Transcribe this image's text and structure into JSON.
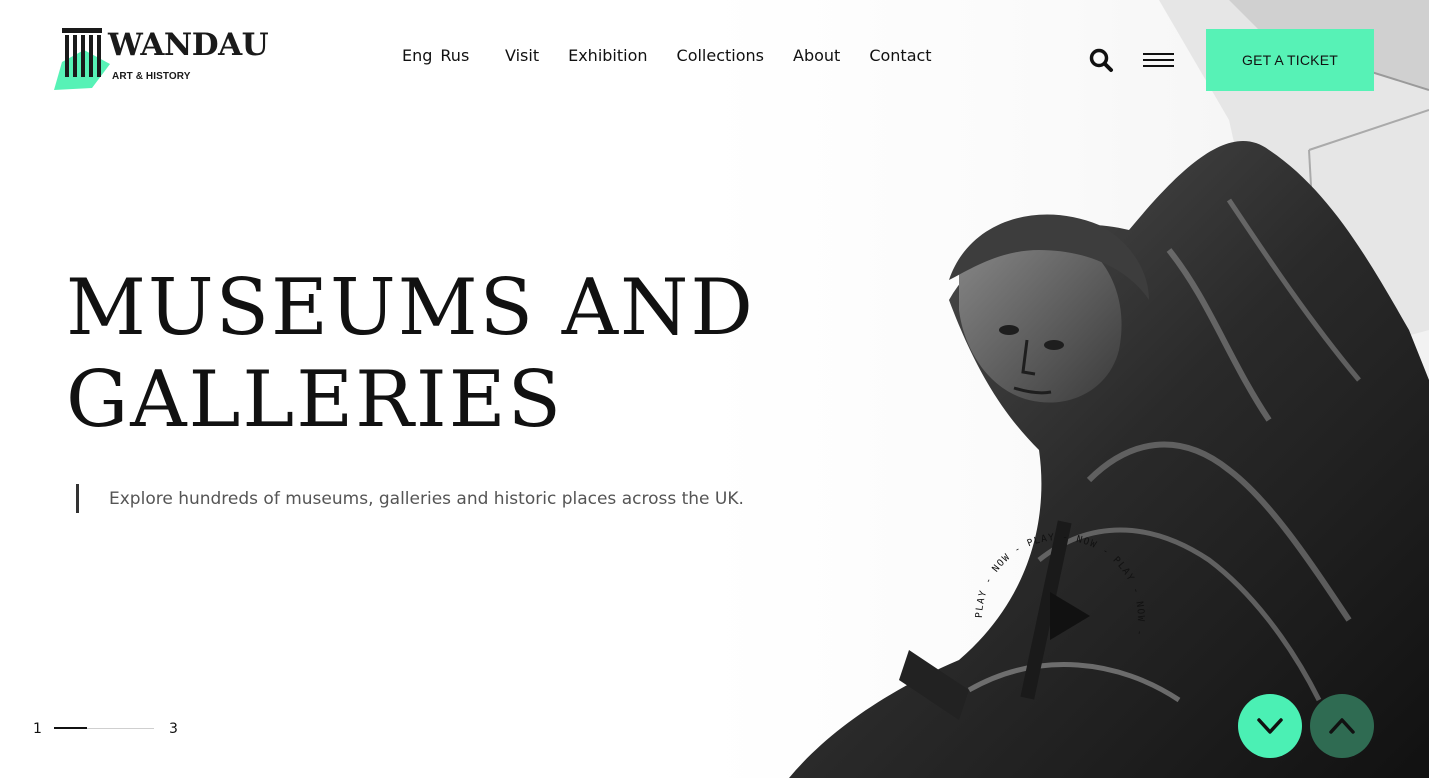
{
  "brand": {
    "name": "WANDAU",
    "tagline": "ART & HISTORY",
    "logo_icon": "column-icon",
    "accent_color": "#57f2b6"
  },
  "header": {
    "languages": [
      "Eng",
      "Rus"
    ],
    "nav_items": [
      {
        "label": "Visit"
      },
      {
        "label": "Exhibition"
      },
      {
        "label": "Collections"
      },
      {
        "label": "About"
      },
      {
        "label": "Contact"
      }
    ],
    "search_icon": "search-icon",
    "menu_icon": "hamburger-icon",
    "ticket_label": "GET A TICKET"
  },
  "hero": {
    "title_line1": "MUSEUMS AND",
    "title_line2": "GALLERIES",
    "description": "Explore hundreds of museums, galleries and historic places across the UK.",
    "image": "statue-photo"
  },
  "pager": {
    "current": "1",
    "total": "3",
    "progress": 0.33
  },
  "play": {
    "ring_text": "PLAY - NOW - PLAY - NOW - PLAY - NOW - ",
    "icon": "play-icon"
  },
  "scroll": {
    "down_icon": "chevron-down-icon",
    "up_icon": "chevron-up-icon",
    "down_color": "#4bf0b4",
    "up_color": "#2f6b52"
  }
}
